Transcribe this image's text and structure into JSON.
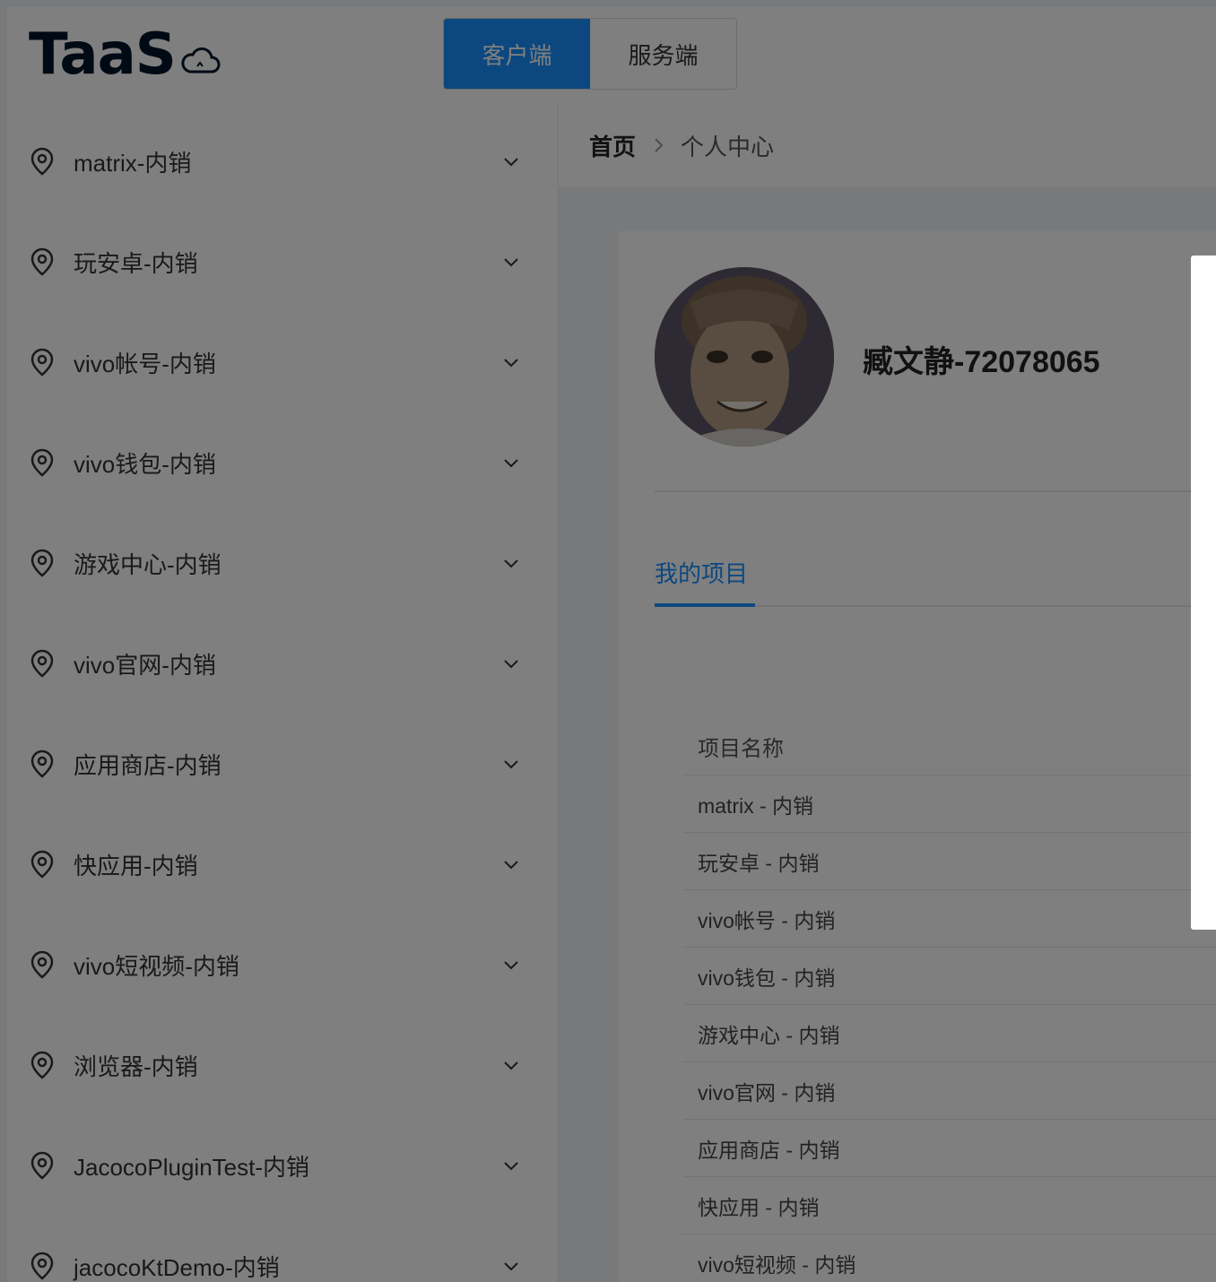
{
  "header": {
    "logo_text": "TaaS",
    "tabs": [
      {
        "label": "客户端",
        "active": true
      },
      {
        "label": "服务端",
        "active": false
      }
    ]
  },
  "sidebar": {
    "items": [
      {
        "label": "matrix-内销"
      },
      {
        "label": "玩安卓-内销"
      },
      {
        "label": "vivo帐号-内销"
      },
      {
        "label": "vivo钱包-内销"
      },
      {
        "label": "游戏中心-内销"
      },
      {
        "label": "vivo官网-内销"
      },
      {
        "label": "应用商店-内销"
      },
      {
        "label": "快应用-内销"
      },
      {
        "label": "vivo短视频-内销"
      },
      {
        "label": "浏览器-内销"
      },
      {
        "label": "JacocoPluginTest-内销"
      },
      {
        "label": "jacocoKtDemo-内销"
      }
    ]
  },
  "breadcrumb": {
    "home": "首页",
    "current": "个人中心"
  },
  "profile": {
    "username": "臧文静-72078065",
    "tab_label": "我的项目"
  },
  "table": {
    "header": "项目名称",
    "rows": [
      "matrix - 内销",
      "玩安卓 - 内销",
      "vivo帐号 - 内销",
      "vivo钱包 - 内销",
      "游戏中心 - 内销",
      "vivo官网 - 内销",
      "应用商店 - 内销",
      "快应用 - 内销",
      "vivo短视频 - 内销"
    ]
  },
  "colors": {
    "accent": "#1890ff",
    "logo": "#001529",
    "overlay": "rgba(0,0,0,0.5)"
  }
}
